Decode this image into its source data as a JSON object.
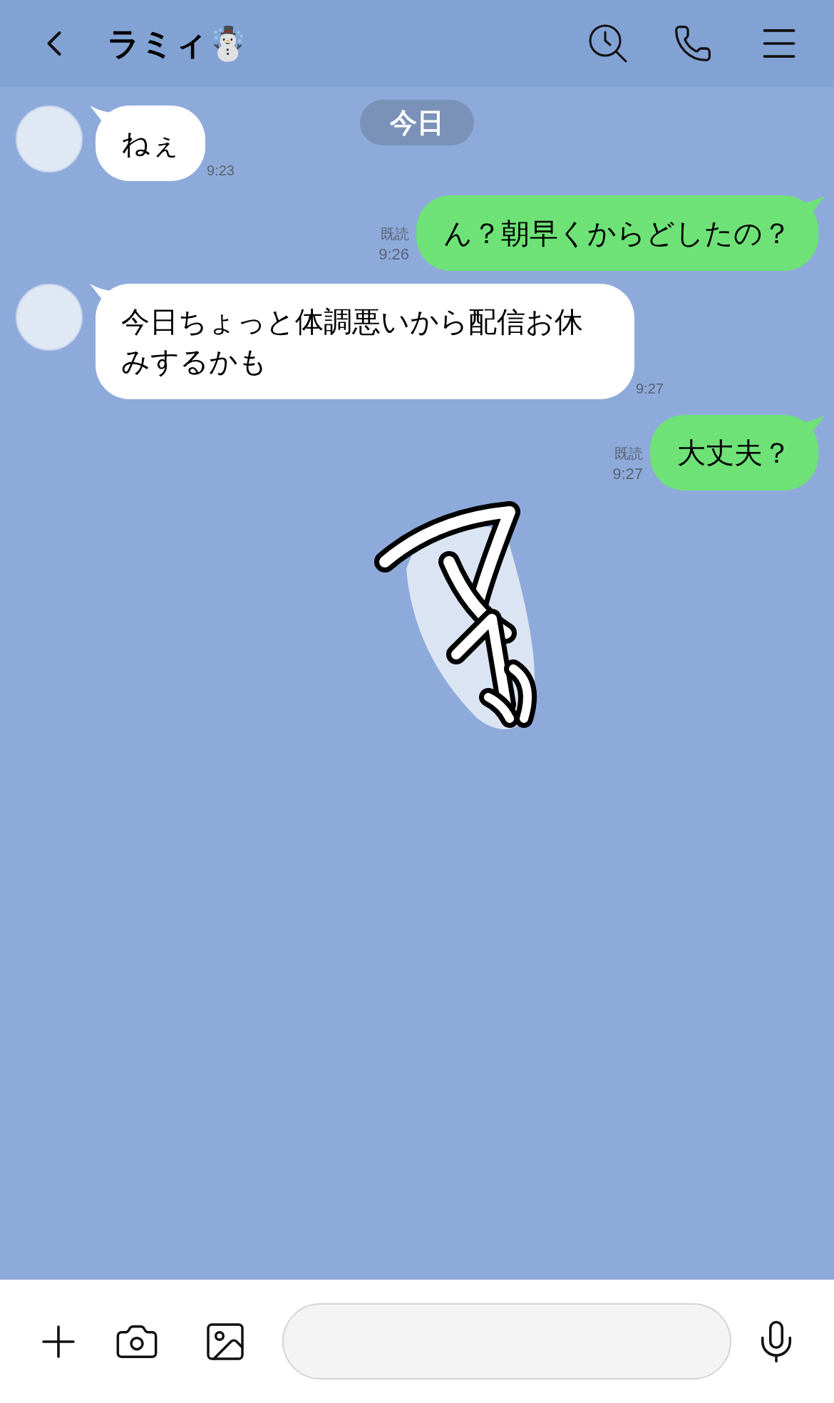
{
  "header": {
    "title": "ラミィ☃️"
  },
  "date_divider": "今日",
  "messages": [
    {
      "kind": "incoming",
      "text": "ねぇ",
      "time": "9:23"
    },
    {
      "kind": "outgoing",
      "text": "ん？朝早くからどしたの？",
      "time": "9:26",
      "read": "既読"
    },
    {
      "kind": "incoming",
      "text": "今日ちょっと体調悪いから配信お休みするかも",
      "time": "9:27"
    },
    {
      "kind": "outgoing",
      "text": "大丈夫？",
      "time": "9:27",
      "read": "既読"
    },
    {
      "kind": "sticker"
    }
  ]
}
